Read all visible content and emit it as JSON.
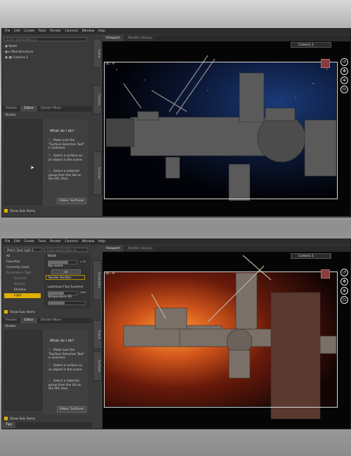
{
  "menu": [
    "File",
    "Edit",
    "Create",
    "Tools",
    "Render",
    "Connect",
    "Window",
    "Help"
  ],
  "top": {
    "search_placeholder": "Enter search filter by",
    "scene_items": [
      "Node",
      "Mainstructure",
      "Camera 1"
    ],
    "side_tabs": [
      "Scene",
      "Camera",
      "Surfaces"
    ],
    "tabs": [
      "Presets",
      "Editor",
      "Shader Mixer"
    ],
    "shader_label": "Shader",
    "help_title": "What do I do?",
    "steps": [
      {
        "n": "1.",
        "text": "Make sure the \"Surface Selection Tool\" is selected."
      },
      {
        "n": "2.",
        "text": "Select a surface on an object in the scene."
      },
      {
        "n": "3.",
        "text": "Select a material group from the list on the left, then"
      }
    ],
    "video_btn": "Video: Surfaces",
    "show_sub": "Show Sub Items",
    "viewport_tabs": [
      "Viewport",
      "Render Library"
    ],
    "camera": "Camera 1",
    "aspect": "16 : 9"
  },
  "bottom": {
    "node_label": "Metric Spot Light 1",
    "search_placeholder": "Enter search filter by",
    "list_items": [
      "All",
      "Favorites",
      "Currently Used",
      "Parameters Tabs",
      "General",
      "Display",
      "Shadow",
      "Light"
    ],
    "props": [
      {
        "label": "Width",
        "value": "1.00"
      },
      {
        "label": "Two Sided",
        "value": ""
      },
      {
        "label": "",
        "value": "Off"
      },
      {
        "label": "Render Emitter",
        "value": ""
      },
      {
        "label": "Luminous Flux (Lumen)",
        "value": "1500"
      },
      {
        "label": "Temperature (K)",
        "value": ""
      }
    ],
    "side_tabs": [
      "Parameters",
      "Scene",
      "Surfaces"
    ],
    "show_sub": "Show Sub Items",
    "tabs": [
      "Presets",
      "Editor",
      "Shader Mixer"
    ],
    "shader_label": "Shader",
    "help_title": "What do I do?",
    "steps": [
      {
        "n": "1.",
        "text": "Make sure the \"Surface Selection Tool\" is selected."
      },
      {
        "n": "2.",
        "text": "Select a surface on an object in the scene."
      },
      {
        "n": "3.",
        "text": "Select a material group from the list on the left, then"
      }
    ],
    "video_btn": "Video: Surfaces",
    "show_sub2": "Show Sub Items",
    "footer_tab": "Tips",
    "viewport_tabs": [
      "Viewport",
      "Render Library"
    ],
    "camera": "Camera 1",
    "aspect": "16 : 9"
  },
  "colors": {
    "accent": "#e0b000",
    "selected_row": "#e0b000",
    "camera_cube": "#8a3b3b"
  }
}
